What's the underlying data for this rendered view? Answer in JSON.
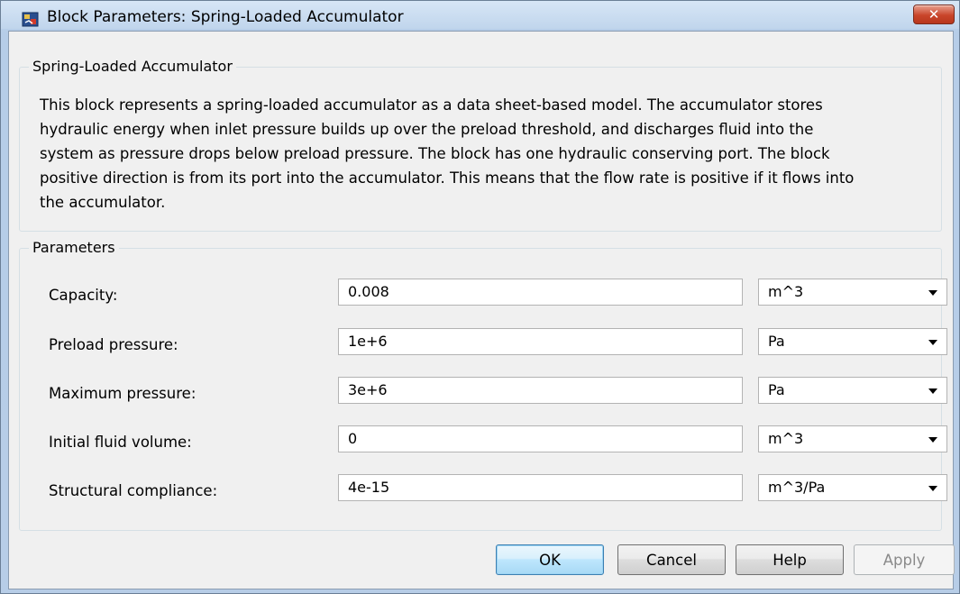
{
  "window": {
    "title": "Block Parameters: Spring-Loaded Accumulator",
    "close_glyph": "✕",
    "icon": "simulink-block-icon"
  },
  "description_group": {
    "legend": "Spring-Loaded Accumulator",
    "lines": [
      "This block represents a spring-loaded accumulator as a data sheet-based model. The accumulator stores",
      "hydraulic energy when inlet pressure builds up over the preload threshold, and discharges fluid into the",
      "system as pressure drops below preload pressure. The block has one hydraulic conserving port. The block",
      "positive direction is from its port into the accumulator. This means that the flow rate is positive if it flows into",
      "the accumulator."
    ]
  },
  "parameters_group": {
    "legend": "Parameters",
    "rows": [
      {
        "label": "Capacity:",
        "value": "0.008",
        "unit": "m^3"
      },
      {
        "label": "Preload pressure:",
        "value": "1e+6",
        "unit": "Pa"
      },
      {
        "label": "Maximum pressure:",
        "value": "3e+6",
        "unit": "Pa"
      },
      {
        "label": "Initial fluid volume:",
        "value": "0",
        "unit": "m^3"
      },
      {
        "label": "Structural compliance:",
        "value": "4e-15",
        "unit": "m^3/Pa"
      }
    ]
  },
  "buttons": {
    "ok": "OK",
    "cancel": "Cancel",
    "help": "Help",
    "apply": "Apply"
  },
  "colors": {
    "close_button": "#c9452a",
    "default_button_border": "#3c7fb1",
    "disabled_text": "#8a8a8a"
  }
}
